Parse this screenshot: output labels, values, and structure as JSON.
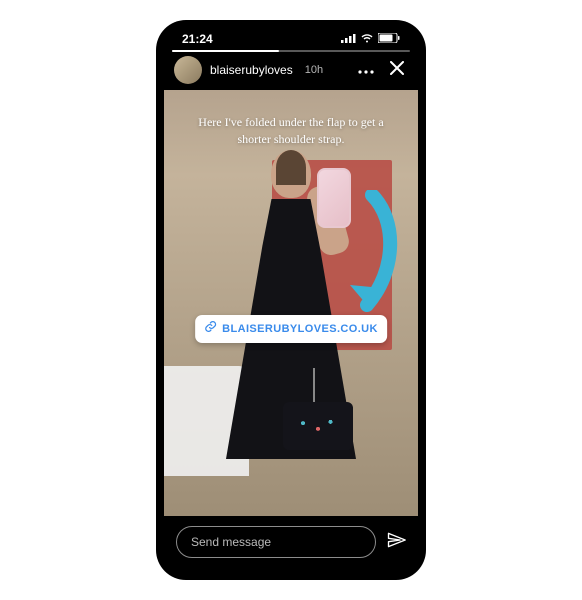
{
  "status": {
    "time": "21:24"
  },
  "story": {
    "username": "blaiserubyloves",
    "time_ago": "10h",
    "overlay_text": "Here I've folded under the flap to get a shorter shoulder strap.",
    "link_sticker": {
      "url_text": "BLAISERUBYLOVES.CO.UK"
    }
  },
  "reply": {
    "placeholder": "Send message"
  }
}
